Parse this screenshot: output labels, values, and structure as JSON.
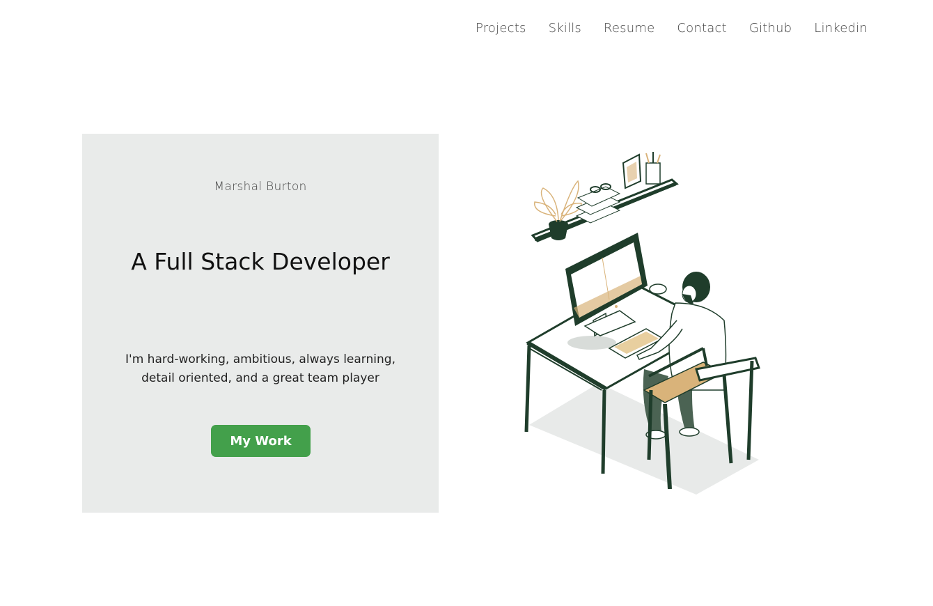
{
  "nav": {
    "items": [
      {
        "label": "Projects"
      },
      {
        "label": "Skills"
      },
      {
        "label": "Resume"
      },
      {
        "label": "Contact"
      },
      {
        "label": "Github"
      },
      {
        "label": "Linkedin"
      }
    ]
  },
  "hero": {
    "name": "Marshal Burton",
    "title": "A Full Stack Developer",
    "description": "I'm hard-working, ambitious, always learning, detail oriented, and a great team player",
    "cta_label": "My Work"
  },
  "colors": {
    "accent_green": "#43a04b",
    "card_bg": "#e9ebea",
    "illustration_dark": "#1f3d2b",
    "illustration_tan": "#d9b37a"
  }
}
